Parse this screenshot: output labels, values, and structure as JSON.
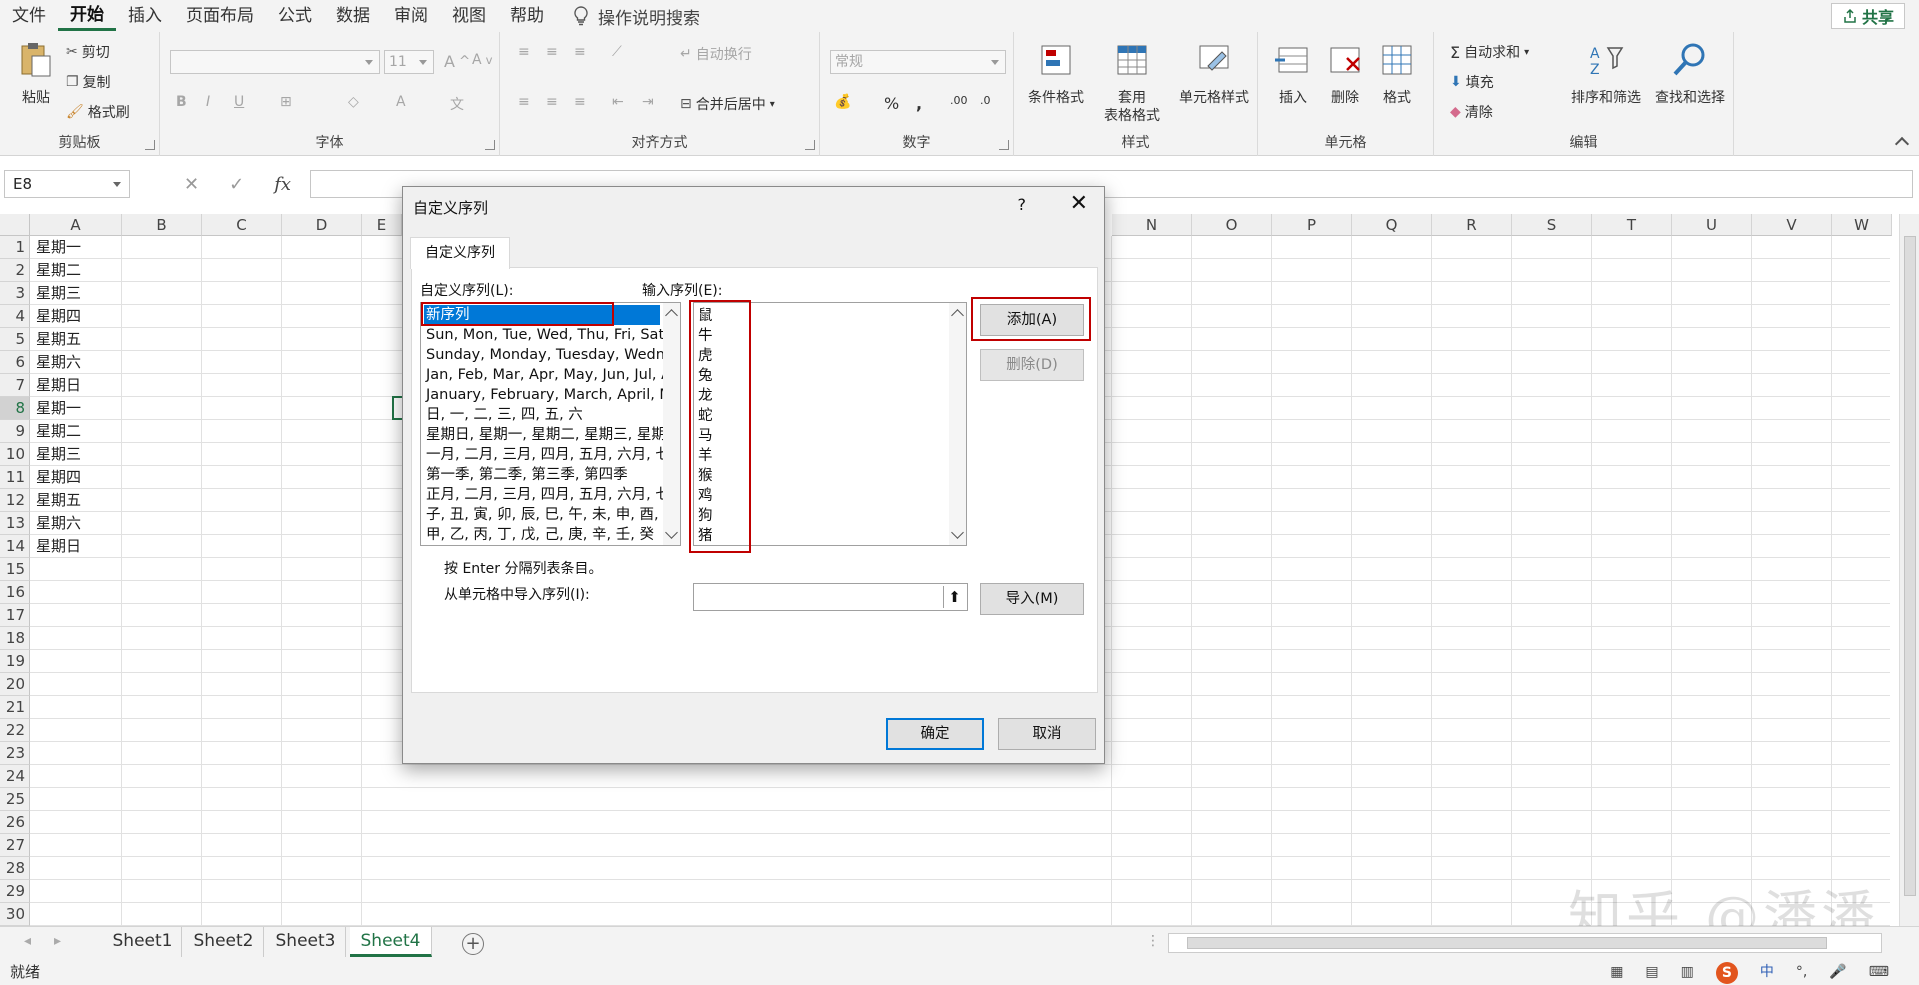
{
  "menu": {
    "items": [
      "文件",
      "开始",
      "插入",
      "页面布局",
      "公式",
      "数据",
      "审阅",
      "视图",
      "帮助"
    ],
    "active_index": 1,
    "tell_me": "操作说明搜索",
    "share": "共享"
  },
  "ribbon": {
    "clipboard": {
      "label": "剪贴板",
      "paste": "粘贴",
      "cut": "剪切",
      "copy": "复制",
      "format_painter": "格式刷"
    },
    "font": {
      "label": "字体",
      "size": "11"
    },
    "alignment": {
      "label": "对齐方式",
      "wrap": "自动换行",
      "merge": "合并后居中"
    },
    "number": {
      "label": "数字",
      "format": "常规"
    },
    "styles": {
      "label": "样式",
      "conditional": "条件格式",
      "table_format_1": "套用",
      "table_format_2": "表格格式",
      "cell_styles": "单元格样式"
    },
    "cells": {
      "label": "单元格",
      "insert": "插入",
      "delete": "删除",
      "format": "格式"
    },
    "editing": {
      "label": "编辑",
      "autosum": "自动求和",
      "fill": "填充",
      "clear": "清除",
      "sort_filter": "排序和筛选",
      "find_select": "查找和选择"
    }
  },
  "formula_bar": {
    "name_box": "E8",
    "fx": "fx",
    "value": ""
  },
  "columns": [
    "A",
    "B",
    "C",
    "D",
    "E",
    "N",
    "O",
    "P",
    "Q",
    "R",
    "S",
    "T",
    "U",
    "V",
    "W"
  ],
  "rows": [
    "1",
    "2",
    "3",
    "4",
    "5",
    "6",
    "7",
    "8",
    "9",
    "10",
    "11",
    "12",
    "13",
    "14",
    "15",
    "16",
    "17",
    "18",
    "19",
    "20",
    "21",
    "22",
    "23",
    "24",
    "25",
    "26",
    "27",
    "28",
    "29",
    "30"
  ],
  "selected_row": "8",
  "cells_a": [
    "星期一",
    "星期二",
    "星期三",
    "星期四",
    "星期五",
    "星期六",
    "星期日",
    "星期一",
    "星期二",
    "星期三",
    "星期四",
    "星期五",
    "星期六",
    "星期日"
  ],
  "sheets": [
    "Sheet1",
    "Sheet2",
    "Sheet3",
    "Sheet4"
  ],
  "active_sheet": "Sheet4",
  "status": {
    "ready": "就绪",
    "ime": "中"
  },
  "watermark": "知乎 @潘潘",
  "dialog": {
    "title": "自定义序列",
    "help": "?",
    "tab": "自定义序列",
    "list_label": "自定义序列(L):",
    "input_label": "输入序列(E):",
    "custom_lists": [
      "新序列",
      "Sun, Mon, Tue, Wed, Thu, Fri, Sat",
      "Sunday, Monday, Tuesday, Wednesday",
      "Jan, Feb, Mar, Apr, May, Jun, Jul, Aug",
      "January, February, March, April, May",
      "日, 一, 二, 三, 四, 五, 六",
      "星期日, 星期一, 星期二, 星期三, 星期四",
      "一月, 二月, 三月, 四月, 五月, 六月, 七月",
      "第一季, 第二季, 第三季, 第四季",
      "正月, 二月, 三月, 四月, 五月, 六月, 七月",
      "子, 丑, 寅, 卯, 辰, 巳, 午, 未, 申, 酉, 戌",
      "甲, 乙, 丙, 丁, 戊, 己, 庚, 辛, 壬, 癸"
    ],
    "input_entries": [
      "鼠",
      "牛",
      "虎",
      "兔",
      "龙",
      "蛇",
      "马",
      "羊",
      "猴",
      "鸡",
      "狗",
      "猪"
    ],
    "add": "添加(A)",
    "delete": "删除(D)",
    "hint": "按 Enter 分隔列表条目。",
    "import_label": "从单元格中导入序列(I):",
    "import": "导入(M)",
    "ok": "确定",
    "cancel": "取消"
  }
}
